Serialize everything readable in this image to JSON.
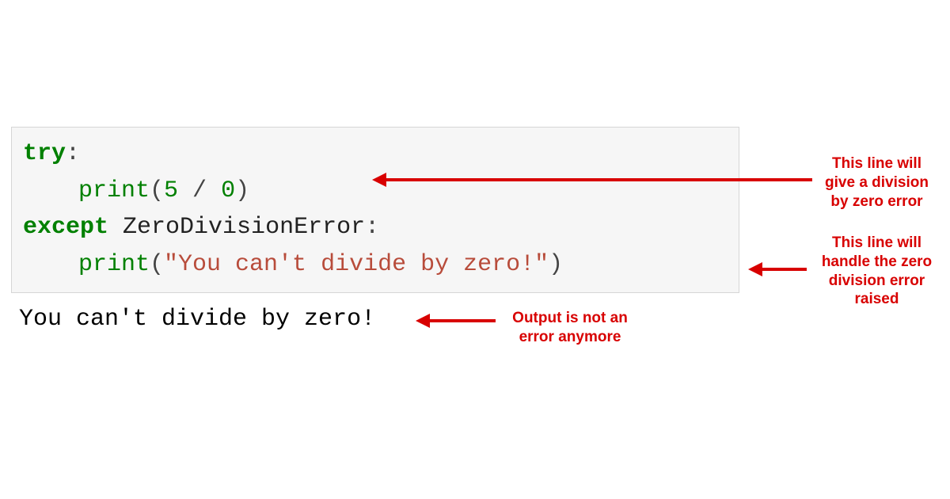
{
  "code": {
    "line1_kw": "try",
    "line1_colon": ":",
    "line2_fn": "print",
    "line2_open": "(",
    "line2_lhs": "5",
    "line2_op": " / ",
    "line2_rhs": "0",
    "line2_close": ")",
    "line3_kw": "except",
    "line3_err": " ZeroDivisionError",
    "line3_colon": ":",
    "line4_fn": "print",
    "line4_open": "(",
    "line4_str": "\"You can't divide by zero!\"",
    "line4_close": ")"
  },
  "output": "You can't divide by zero!",
  "annotations": {
    "a1": "This line will give a division by zero error",
    "a2": "This line will handle the zero division error raised",
    "a3": "Output is not an error anymore"
  }
}
